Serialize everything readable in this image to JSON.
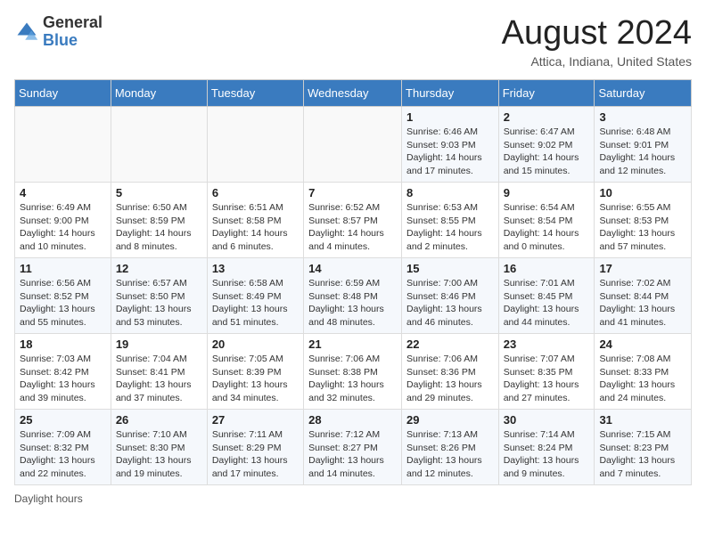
{
  "header": {
    "logo_general": "General",
    "logo_blue": "Blue",
    "main_title": "August 2024",
    "subtitle": "Attica, Indiana, United States"
  },
  "calendar": {
    "days_of_week": [
      "Sunday",
      "Monday",
      "Tuesday",
      "Wednesday",
      "Thursday",
      "Friday",
      "Saturday"
    ],
    "weeks": [
      [
        {
          "day": "",
          "info": ""
        },
        {
          "day": "",
          "info": ""
        },
        {
          "day": "",
          "info": ""
        },
        {
          "day": "",
          "info": ""
        },
        {
          "day": "1",
          "info": "Sunrise: 6:46 AM\nSunset: 9:03 PM\nDaylight: 14 hours\nand 17 minutes."
        },
        {
          "day": "2",
          "info": "Sunrise: 6:47 AM\nSunset: 9:02 PM\nDaylight: 14 hours\nand 15 minutes."
        },
        {
          "day": "3",
          "info": "Sunrise: 6:48 AM\nSunset: 9:01 PM\nDaylight: 14 hours\nand 12 minutes."
        }
      ],
      [
        {
          "day": "4",
          "info": "Sunrise: 6:49 AM\nSunset: 9:00 PM\nDaylight: 14 hours\nand 10 minutes."
        },
        {
          "day": "5",
          "info": "Sunrise: 6:50 AM\nSunset: 8:59 PM\nDaylight: 14 hours\nand 8 minutes."
        },
        {
          "day": "6",
          "info": "Sunrise: 6:51 AM\nSunset: 8:58 PM\nDaylight: 14 hours\nand 6 minutes."
        },
        {
          "day": "7",
          "info": "Sunrise: 6:52 AM\nSunset: 8:57 PM\nDaylight: 14 hours\nand 4 minutes."
        },
        {
          "day": "8",
          "info": "Sunrise: 6:53 AM\nSunset: 8:55 PM\nDaylight: 14 hours\nand 2 minutes."
        },
        {
          "day": "9",
          "info": "Sunrise: 6:54 AM\nSunset: 8:54 PM\nDaylight: 14 hours\nand 0 minutes."
        },
        {
          "day": "10",
          "info": "Sunrise: 6:55 AM\nSunset: 8:53 PM\nDaylight: 13 hours\nand 57 minutes."
        }
      ],
      [
        {
          "day": "11",
          "info": "Sunrise: 6:56 AM\nSunset: 8:52 PM\nDaylight: 13 hours\nand 55 minutes."
        },
        {
          "day": "12",
          "info": "Sunrise: 6:57 AM\nSunset: 8:50 PM\nDaylight: 13 hours\nand 53 minutes."
        },
        {
          "day": "13",
          "info": "Sunrise: 6:58 AM\nSunset: 8:49 PM\nDaylight: 13 hours\nand 51 minutes."
        },
        {
          "day": "14",
          "info": "Sunrise: 6:59 AM\nSunset: 8:48 PM\nDaylight: 13 hours\nand 48 minutes."
        },
        {
          "day": "15",
          "info": "Sunrise: 7:00 AM\nSunset: 8:46 PM\nDaylight: 13 hours\nand 46 minutes."
        },
        {
          "day": "16",
          "info": "Sunrise: 7:01 AM\nSunset: 8:45 PM\nDaylight: 13 hours\nand 44 minutes."
        },
        {
          "day": "17",
          "info": "Sunrise: 7:02 AM\nSunset: 8:44 PM\nDaylight: 13 hours\nand 41 minutes."
        }
      ],
      [
        {
          "day": "18",
          "info": "Sunrise: 7:03 AM\nSunset: 8:42 PM\nDaylight: 13 hours\nand 39 minutes."
        },
        {
          "day": "19",
          "info": "Sunrise: 7:04 AM\nSunset: 8:41 PM\nDaylight: 13 hours\nand 37 minutes."
        },
        {
          "day": "20",
          "info": "Sunrise: 7:05 AM\nSunset: 8:39 PM\nDaylight: 13 hours\nand 34 minutes."
        },
        {
          "day": "21",
          "info": "Sunrise: 7:06 AM\nSunset: 8:38 PM\nDaylight: 13 hours\nand 32 minutes."
        },
        {
          "day": "22",
          "info": "Sunrise: 7:06 AM\nSunset: 8:36 PM\nDaylight: 13 hours\nand 29 minutes."
        },
        {
          "day": "23",
          "info": "Sunrise: 7:07 AM\nSunset: 8:35 PM\nDaylight: 13 hours\nand 27 minutes."
        },
        {
          "day": "24",
          "info": "Sunrise: 7:08 AM\nSunset: 8:33 PM\nDaylight: 13 hours\nand 24 minutes."
        }
      ],
      [
        {
          "day": "25",
          "info": "Sunrise: 7:09 AM\nSunset: 8:32 PM\nDaylight: 13 hours\nand 22 minutes."
        },
        {
          "day": "26",
          "info": "Sunrise: 7:10 AM\nSunset: 8:30 PM\nDaylight: 13 hours\nand 19 minutes."
        },
        {
          "day": "27",
          "info": "Sunrise: 7:11 AM\nSunset: 8:29 PM\nDaylight: 13 hours\nand 17 minutes."
        },
        {
          "day": "28",
          "info": "Sunrise: 7:12 AM\nSunset: 8:27 PM\nDaylight: 13 hours\nand 14 minutes."
        },
        {
          "day": "29",
          "info": "Sunrise: 7:13 AM\nSunset: 8:26 PM\nDaylight: 13 hours\nand 12 minutes."
        },
        {
          "day": "30",
          "info": "Sunrise: 7:14 AM\nSunset: 8:24 PM\nDaylight: 13 hours\nand 9 minutes."
        },
        {
          "day": "31",
          "info": "Sunrise: 7:15 AM\nSunset: 8:23 PM\nDaylight: 13 hours\nand 7 minutes."
        }
      ]
    ]
  },
  "footer": {
    "daylight_note": "Daylight hours"
  },
  "colors": {
    "header_bg": "#3a7bbf",
    "accent": "#3a7bbf"
  }
}
